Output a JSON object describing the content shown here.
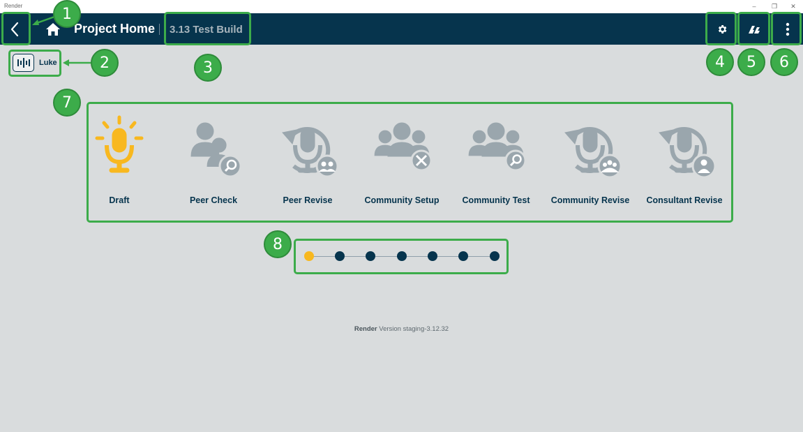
{
  "window": {
    "title": "Render",
    "min_glyph": "–",
    "max_glyph": "❐",
    "close_glyph": "✕"
  },
  "header": {
    "page_title": "Project Home",
    "project_name": "3.13 Test Build"
  },
  "user": {
    "name": "Luke"
  },
  "workflow": {
    "steps": [
      {
        "label": "Draft",
        "icon": "microphone-icon",
        "active": true
      },
      {
        "label": "Peer Check",
        "icon": "peer-check-icon"
      },
      {
        "label": "Peer Revise",
        "icon": "peer-revise-icon"
      },
      {
        "label": "Community Setup",
        "icon": "community-setup-icon"
      },
      {
        "label": "Community Test",
        "icon": "community-test-icon"
      },
      {
        "label": "Community Revise",
        "icon": "community-revise-icon"
      },
      {
        "label": "Consultant Revise",
        "icon": "consultant-revise-icon"
      }
    ]
  },
  "progress": {
    "total": 7,
    "current": 1
  },
  "footer": {
    "app": "Render",
    "version_text": "Version staging-3.12.32"
  },
  "annotations": [
    "1",
    "2",
    "3",
    "4",
    "5",
    "6",
    "7",
    "8"
  ],
  "colors": {
    "header_bg": "#06344d",
    "page_bg": "#d9dcdd",
    "accent_active": "#f8b81f",
    "icon_inactive": "#9aa6ad",
    "annotation_green": "#3cac4a"
  }
}
